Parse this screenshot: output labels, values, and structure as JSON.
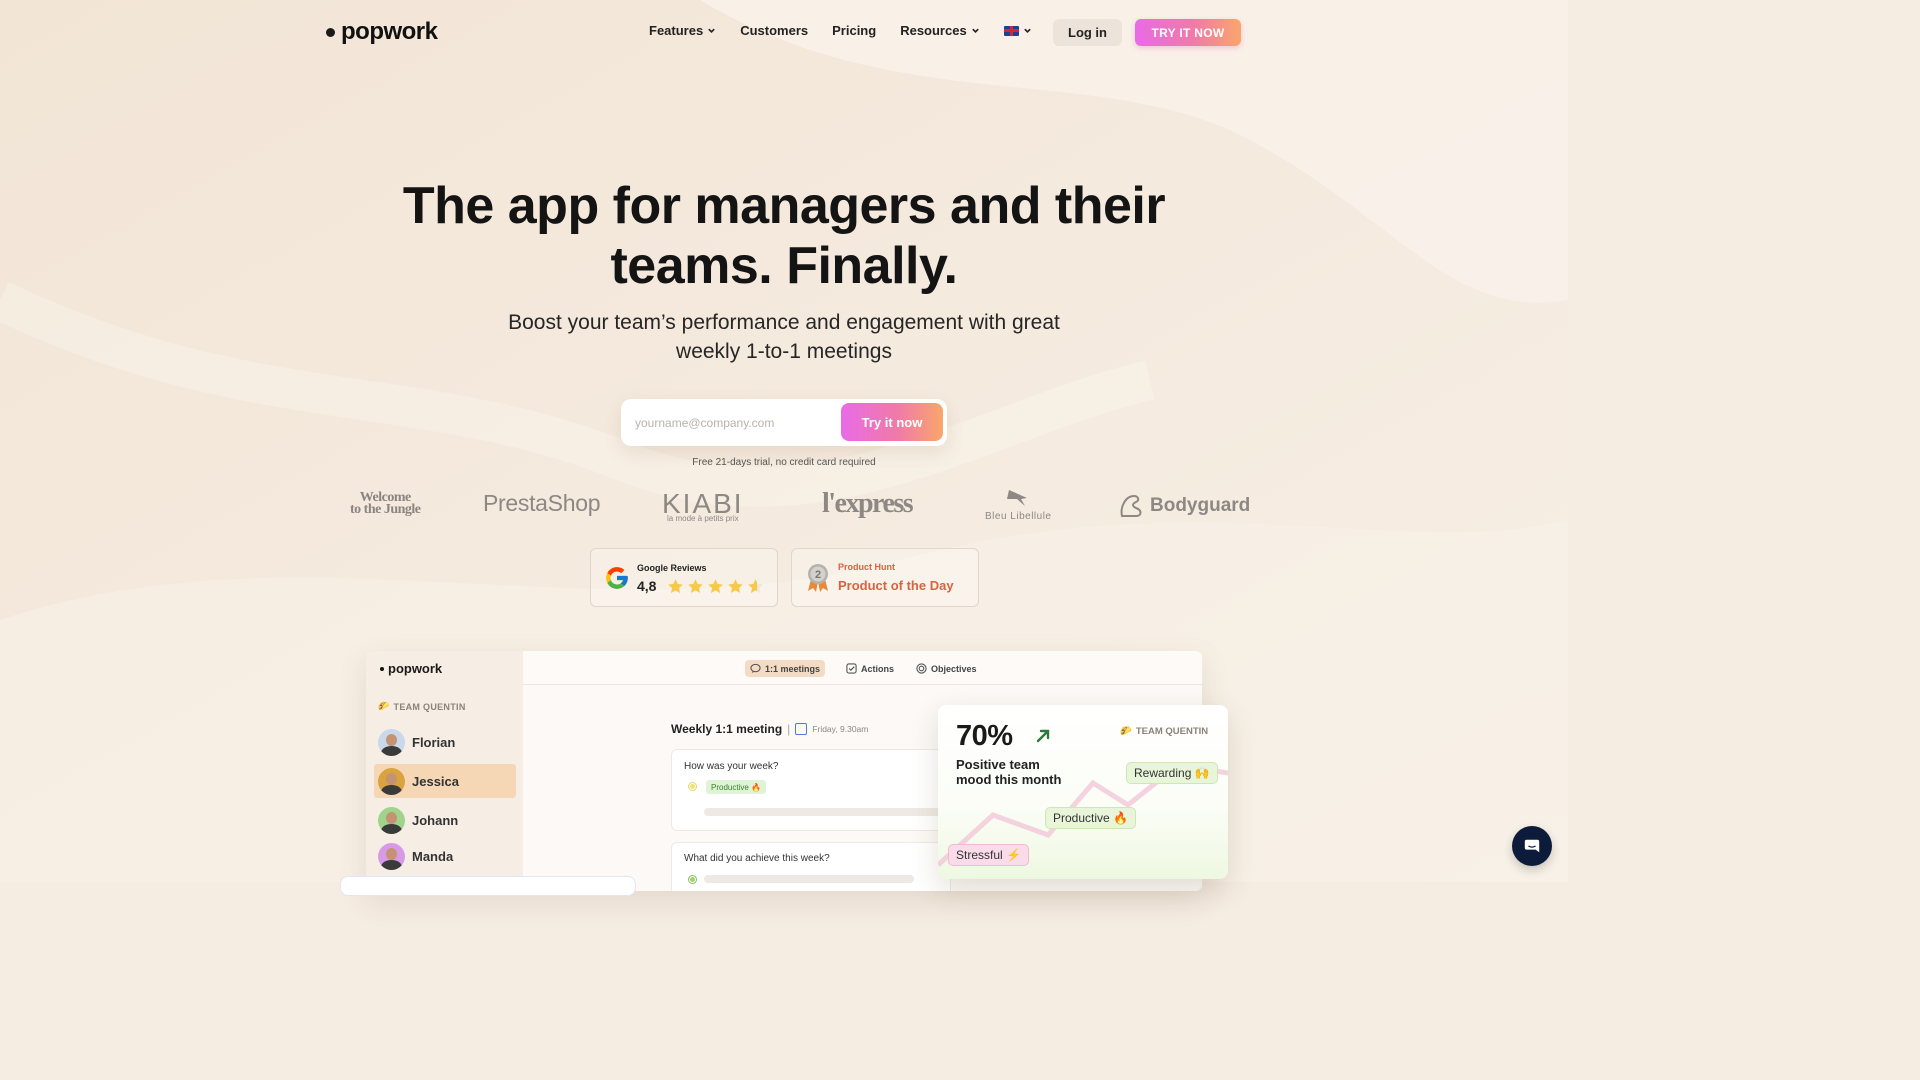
{
  "brand": {
    "name": "popwork"
  },
  "nav": {
    "features": "Features",
    "customers": "Customers",
    "pricing": "Pricing",
    "resources": "Resources",
    "login": "Log in",
    "try_cta": "TRY IT NOW"
  },
  "hero": {
    "title_line1": "The app for managers and their",
    "title_line2": "teams. Finally.",
    "subtitle_line1": "Boost your team’s performance and engagement with great",
    "subtitle_line2": "weekly 1-to-1 meetings",
    "email_placeholder": "yourname@company.com",
    "cta": "Try it now",
    "trial_note": "Free 21-days trial, no credit card required"
  },
  "customer_logos": {
    "wttj_line1": "Welcome",
    "wttj_line2": "to the Jungle",
    "prestashop": "PrestaShop",
    "kiabi": "KIABI",
    "kiabi_tagline": "la mode à petits prix",
    "lexpress": "l'express",
    "bleu": "Bleu Libellule",
    "bodyguard": "Bodyguard"
  },
  "reviews": {
    "google": {
      "label": "Google Reviews",
      "score": "4,8",
      "rating": 4.8
    },
    "producthunt": {
      "label": "Product Hunt",
      "award": "Product of the Day",
      "rank": "2"
    }
  },
  "app_preview": {
    "logo": "popwork",
    "team_label": "TEAM QUENTIN",
    "members": [
      "Florian",
      "Jessica",
      "Johann",
      "Manda"
    ],
    "active_member": "Jessica",
    "tabs": [
      "1:1 meetings",
      "Actions",
      "Objectives"
    ],
    "meeting_title": "Weekly 1:1 meeting",
    "meeting_date": "Friday, 9.30am",
    "q1": "How was your week?",
    "q1_answer": "Productive 🔥",
    "q2": "What did you achieve this week?"
  },
  "mood_card": {
    "percent": "70%",
    "desc_line1": "Positive team",
    "desc_line2": "mood this month",
    "team": "TEAM QUENTIN",
    "tag_rewarding": "Rewarding 🙌",
    "tag_productive": "Productive 🔥",
    "tag_stressful": "Stressful ⚡"
  },
  "colors": {
    "accent_gradient_start": "#e86be6",
    "accent_gradient_end": "#f9a66b",
    "background": "#f5ece2",
    "producthunt": "#d9623f",
    "chat": "#0d1b3a"
  }
}
